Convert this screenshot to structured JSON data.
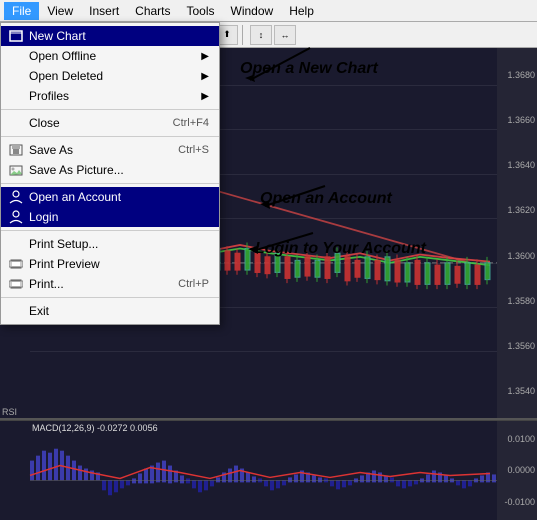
{
  "menubar": {
    "items": [
      "File",
      "View",
      "Insert",
      "Charts",
      "Tools",
      "Window",
      "Help"
    ]
  },
  "dropdown": {
    "items": [
      {
        "id": "new-chart",
        "label": "New Chart",
        "icon": "chart",
        "shortcut": "",
        "arrow": false,
        "highlighted": true
      },
      {
        "id": "open-offline",
        "label": "Open Offline",
        "icon": "",
        "shortcut": "",
        "arrow": true,
        "highlighted": false
      },
      {
        "id": "open-deleted",
        "label": "Open Deleted",
        "icon": "",
        "shortcut": "",
        "arrow": true,
        "highlighted": false
      },
      {
        "id": "profiles",
        "label": "Profiles",
        "icon": "",
        "shortcut": "",
        "arrow": true,
        "highlighted": false
      },
      {
        "id": "sep1",
        "label": "",
        "type": "separator"
      },
      {
        "id": "close",
        "label": "Close",
        "icon": "",
        "shortcut": "Ctrl+F4",
        "arrow": false,
        "highlighted": false
      },
      {
        "id": "sep2",
        "label": "",
        "type": "separator"
      },
      {
        "id": "save-as",
        "label": "Save As",
        "icon": "save",
        "shortcut": "Ctrl+S",
        "arrow": false,
        "highlighted": false
      },
      {
        "id": "save-as-picture",
        "label": "Save As Picture...",
        "icon": "save-pic",
        "shortcut": "",
        "arrow": false,
        "highlighted": false
      },
      {
        "id": "sep3",
        "label": "",
        "type": "separator"
      },
      {
        "id": "open-account",
        "label": "Open an Account",
        "icon": "user",
        "shortcut": "",
        "arrow": false,
        "highlighted": true
      },
      {
        "id": "login",
        "label": "Login",
        "icon": "login",
        "shortcut": "",
        "arrow": false,
        "highlighted": true
      },
      {
        "id": "sep4",
        "label": "",
        "type": "separator"
      },
      {
        "id": "print-setup",
        "label": "Print Setup...",
        "icon": "",
        "shortcut": "",
        "arrow": false,
        "highlighted": false
      },
      {
        "id": "print-preview",
        "label": "Print Preview",
        "icon": "print",
        "shortcut": "",
        "arrow": false,
        "highlighted": false
      },
      {
        "id": "print",
        "label": "Print...",
        "icon": "print2",
        "shortcut": "Ctrl+P",
        "arrow": false,
        "highlighted": false
      },
      {
        "id": "sep5",
        "label": "",
        "type": "separator"
      },
      {
        "id": "exit",
        "label": "Exit",
        "icon": "",
        "shortcut": "",
        "arrow": false,
        "highlighted": false
      }
    ]
  },
  "annotations": [
    {
      "id": "ann1",
      "text": "Open a New Chart"
    },
    {
      "id": "ann2",
      "text": "Open an Account"
    },
    {
      "id": "ann3",
      "text": "Login to Your Account"
    }
  ],
  "macd": {
    "label": "MACD(12,26,9) -0.0272 0.0056"
  },
  "chart": {
    "y_labels": [
      "1.3680",
      "1.3660",
      "1.3640",
      "1.3620",
      "1.3600",
      "1.3580",
      "1.3560",
      "1.3540"
    ]
  }
}
